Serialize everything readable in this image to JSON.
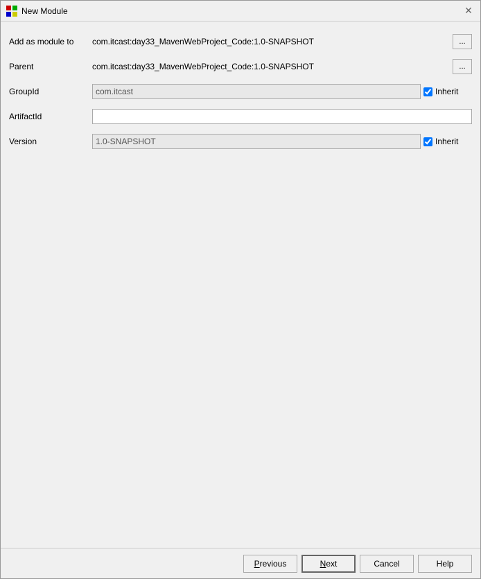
{
  "dialog": {
    "title": "New Module",
    "icon": "module-icon"
  },
  "form": {
    "add_as_module_to_label": "Add as module to",
    "add_as_module_to_value": "com.itcast:day33_MavenWebProject_Code:1.0-SNAPSHOT",
    "parent_label": "Parent",
    "parent_value": "com.itcast:day33_MavenWebProject_Code:1.0-SNAPSHOT",
    "group_id_label": "GroupId",
    "group_id_value": "com.itcast",
    "artifact_id_label": "ArtifactId",
    "artifact_id_value": "",
    "version_label": "Version",
    "version_value": "1.0-SNAPSHOT",
    "browse_label": "...",
    "inherit_label": "Inherit"
  },
  "buttons": {
    "previous_label": "Previous",
    "next_label": "Next",
    "cancel_label": "Cancel",
    "help_label": "Help"
  }
}
